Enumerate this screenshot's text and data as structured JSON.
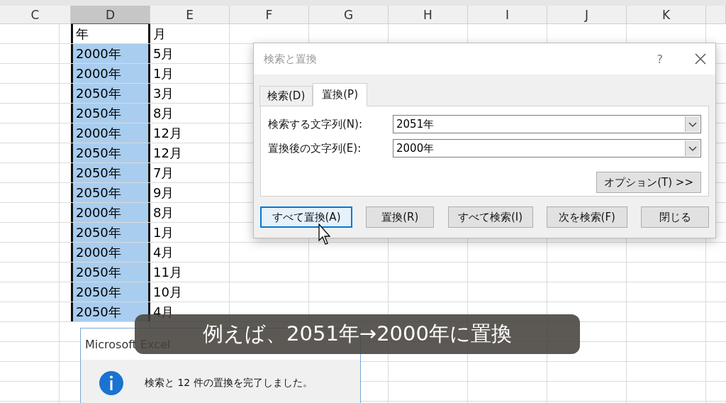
{
  "sheet": {
    "columns": [
      {
        "label": "C",
        "selected": false
      },
      {
        "label": "D",
        "selected": true
      },
      {
        "label": "E",
        "selected": false
      },
      {
        "label": "F",
        "selected": false
      },
      {
        "label": "G",
        "selected": false
      },
      {
        "label": "H",
        "selected": false
      },
      {
        "label": "I",
        "selected": false
      },
      {
        "label": "J",
        "selected": false
      },
      {
        "label": "K",
        "selected": false
      }
    ],
    "rows": [
      {
        "year": "年",
        "month": "月",
        "selected": false
      },
      {
        "year": "2000年",
        "month": "5月",
        "selected": true
      },
      {
        "year": "2000年",
        "month": "1月",
        "selected": true
      },
      {
        "year": "2050年",
        "month": "3月",
        "selected": true
      },
      {
        "year": "2050年",
        "month": "8月",
        "selected": true
      },
      {
        "year": "2000年",
        "month": "12月",
        "selected": true
      },
      {
        "year": "2050年",
        "month": "12月",
        "selected": true
      },
      {
        "year": "2050年",
        "month": "7月",
        "selected": true
      },
      {
        "year": "2050年",
        "month": "9月",
        "selected": true
      },
      {
        "year": "2000年",
        "month": "8月",
        "selected": true
      },
      {
        "year": "2050年",
        "month": "1月",
        "selected": true
      },
      {
        "year": "2000年",
        "month": "4月",
        "selected": true
      },
      {
        "year": "2050年",
        "month": "11月",
        "selected": true
      },
      {
        "year": "2050年",
        "month": "10月",
        "selected": true
      },
      {
        "year": "2050年",
        "month": "4月",
        "selected": true
      }
    ]
  },
  "find_replace_dialog": {
    "title": "検索と置換",
    "help": "?",
    "tabs": [
      {
        "label": "検索(D)",
        "selected": false
      },
      {
        "label": "置換(P)",
        "selected": true
      }
    ],
    "fields": [
      {
        "label": "検索する文字列(N):",
        "value": "2051年"
      },
      {
        "label": "置換後の文字列(E):",
        "value": "2000年"
      }
    ],
    "options_button": "オプション(T) >>",
    "buttons": [
      {
        "label": "すべて置換(A)",
        "focused": true
      },
      {
        "label": "置換(R)",
        "focused": false
      },
      {
        "label": "すべて検索(I)",
        "focused": false
      },
      {
        "label": "次を検索(F)",
        "focused": false
      },
      {
        "label": "閉じる",
        "focused": false
      }
    ]
  },
  "message_box": {
    "title": "Microsoft Excel",
    "message": "検索と 12 件の置換を完了しました。"
  },
  "caption": "例えば、2051年→2000年に置換"
}
